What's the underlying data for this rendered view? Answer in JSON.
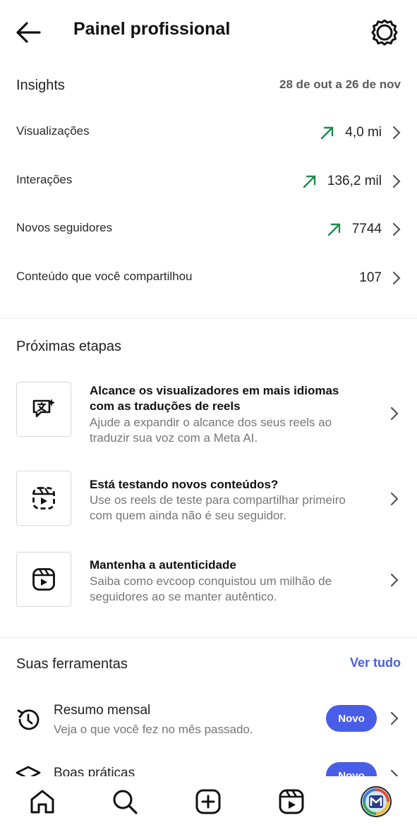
{
  "header": {
    "title": "Painel profissional",
    "back_icon": "arrow-left-icon",
    "settings_icon": "gear-icon"
  },
  "insights": {
    "title": "Insights",
    "date_range": "28 de out a 26 de nov",
    "trend_color": "#1f8a4c",
    "metrics": [
      {
        "label": "Visualizações",
        "value": "4,0 mi",
        "trend": "up"
      },
      {
        "label": "Interações",
        "value": "136,2 mil",
        "trend": "up"
      },
      {
        "label": "Novos seguidores",
        "value": "7744",
        "trend": "up"
      },
      {
        "label": "Conteúdo que você compartilhou",
        "value": "107",
        "trend": "none"
      }
    ]
  },
  "next_steps": {
    "title": "Próximas etapas",
    "items": [
      {
        "icon": "translate-icon",
        "title_lines": [
          "Alcance os visualizadores em mais idiomas",
          "com as traduções de reels"
        ],
        "desc_lines": [
          "Ajude a expandir o alcance dos seus reels ao",
          "traduzir sua voz com a Meta AI."
        ]
      },
      {
        "icon": "dashed-reels-icon",
        "title_lines": [
          "Está testando novos conteúdos?"
        ],
        "desc_lines": [
          "Use os reels de teste para compartilhar primeiro",
          "com quem ainda não é seu seguidor."
        ]
      },
      {
        "icon": "reels-icon",
        "title_lines": [
          "Mantenha a autenticidade"
        ],
        "desc_lines": [
          "Saiba como evcoop conquistou um milhão de",
          "seguidores ao se manter autêntico."
        ]
      }
    ]
  },
  "tools": {
    "title": "Suas ferramentas",
    "see_all": "Ver tudo",
    "accent_color": "#4a5de8",
    "items": [
      {
        "icon": "history-icon",
        "title": "Resumo mensal",
        "desc": "Veja o que você fez no mês passado.",
        "badge": "Novo"
      },
      {
        "icon": "graduation-cap-icon",
        "title": "Boas práticas",
        "desc": "",
        "badge": "Novo"
      }
    ]
  },
  "bottom_nav": {
    "items": [
      {
        "icon": "home-icon"
      },
      {
        "icon": "search-icon"
      },
      {
        "icon": "create-icon"
      },
      {
        "icon": "reels-icon"
      },
      {
        "icon": "profile-avatar"
      }
    ]
  }
}
